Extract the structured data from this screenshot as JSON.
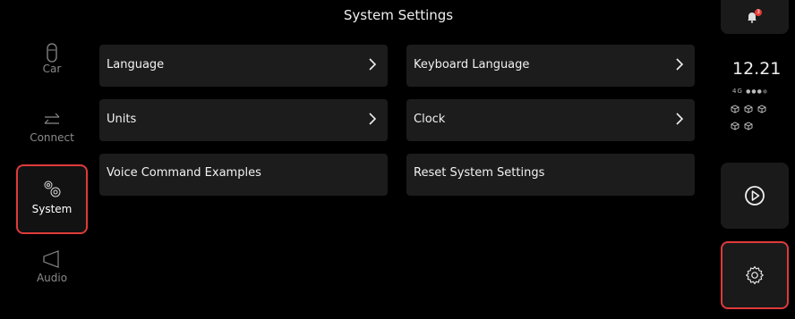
{
  "header": {
    "title": "System Settings"
  },
  "nav": {
    "items": [
      {
        "label": "Car"
      },
      {
        "label": "Connect"
      },
      {
        "label": "System"
      },
      {
        "label": "Audio"
      }
    ]
  },
  "tiles": [
    {
      "label": "Language"
    },
    {
      "label": "Keyboard Language"
    },
    {
      "label": "Units"
    },
    {
      "label": "Clock"
    },
    {
      "label": "Voice Command Examples"
    },
    {
      "label": "Reset System Settings"
    }
  ],
  "status": {
    "time": "12.21",
    "network": "4G",
    "notification_count": "3"
  },
  "icons": {
    "notification": "bell-icon",
    "play": "play-icon",
    "settings": "gear-icon"
  },
  "colors": {
    "highlight": "#e03a3a",
    "badge": "#e53935",
    "tile_bg": "#1c1c1c",
    "background": "#000000"
  }
}
